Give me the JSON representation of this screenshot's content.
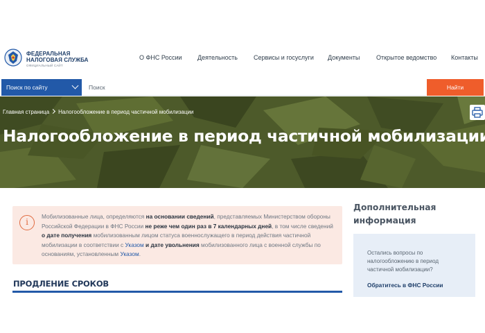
{
  "header": {
    "logo_line1": "ФЕДЕРАЛЬНАЯ",
    "logo_line2": "НАЛОГОВАЯ СЛУЖБА",
    "logo_sub": "ОФИЦИАЛЬНЫЙ САЙТ",
    "nav": [
      "О ФНС России",
      "Деятельность",
      "Сервисы и госуслуги",
      "Документы",
      "Открытое ведомство",
      "Контакты"
    ]
  },
  "search": {
    "scope": "Поиск по сайту",
    "placeholder": "Поиск",
    "button": "Найти"
  },
  "breadcrumb": [
    "Главная страница",
    "Налогообложение в период частичной мобилизации"
  ],
  "page_title": "Налогообложение в период частичной мобилизации",
  "notice": {
    "t1": "Мобилизованные лица, определяются ",
    "b1": "на основании сведений",
    "t2": ", представляемых Министерством обороны Российской Федерации в ФНС России ",
    "b2": "не реже чем один раз в 7 календарных дней",
    "t3": ", в том числе сведений ",
    "b3": "о дате получения",
    "t4": " мобилизованным лицом статуса военнослужащего в период действия частичной мобилизации в соответствии с ",
    "l1": "Указом",
    "b4": " и дате увольнения",
    "t5": " мобилизованного лица с военной службы по основаниям, установленным ",
    "l2": "Указом",
    "t6": "."
  },
  "section_heading": "ПРОДЛЕНИЕ СРОКОВ",
  "sidebar": {
    "heading": "Дополнительная информация",
    "question": "Остались вопросы по налогообложению в период частичной мобилизации?",
    "link": "Обратитесь в ФНС России"
  },
  "colors": {
    "brand_blue": "#2259a8",
    "accent_orange": "#ef5d2b",
    "hero_green": "#4e5b2a",
    "notice_bg": "#fbe9e3"
  },
  "icons": [
    "fns-emblem-icon",
    "chevron-down-icon",
    "chevron-right-icon",
    "print-icon",
    "info-icon"
  ]
}
